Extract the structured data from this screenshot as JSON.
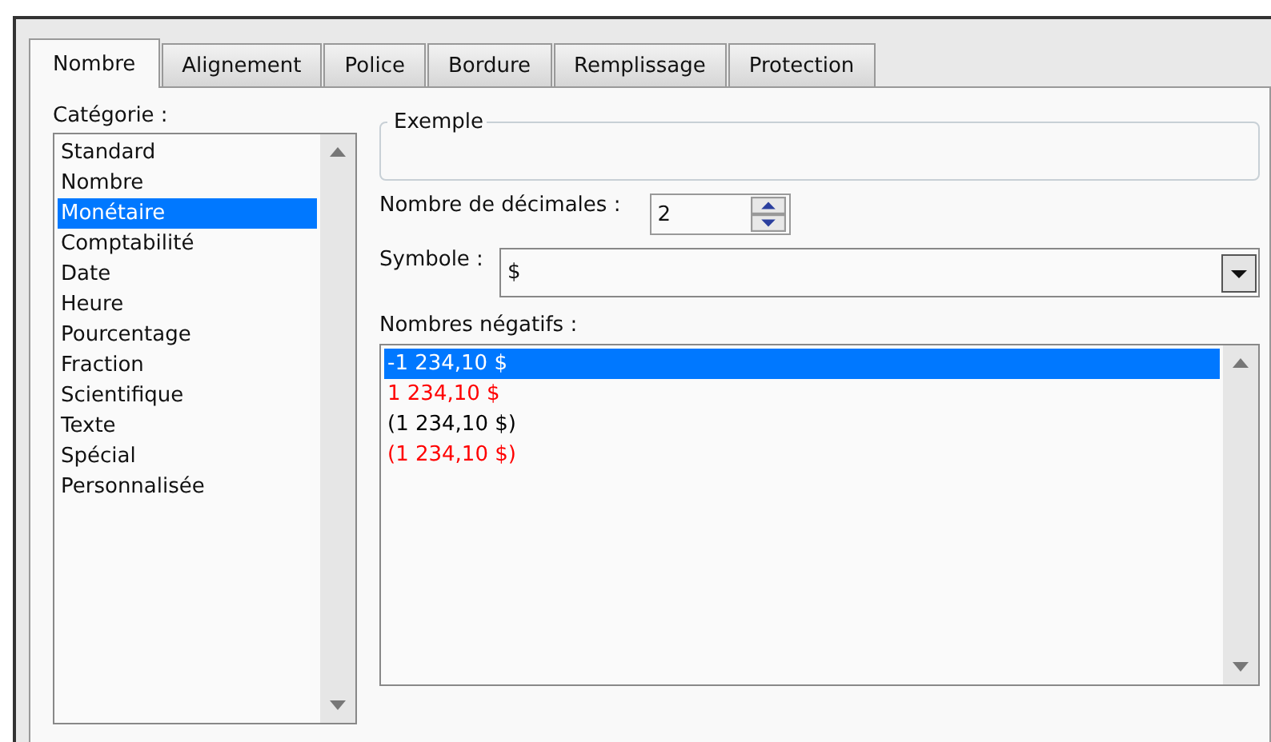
{
  "tabs": [
    {
      "label": "Nombre",
      "selected": true
    },
    {
      "label": "Alignement",
      "selected": false
    },
    {
      "label": "Police",
      "selected": false
    },
    {
      "label": "Bordure",
      "selected": false
    },
    {
      "label": "Remplissage",
      "selected": false
    },
    {
      "label": "Protection",
      "selected": false
    }
  ],
  "category": {
    "label": "Catégorie :",
    "items": [
      {
        "label": "Standard",
        "selected": false
      },
      {
        "label": "Nombre",
        "selected": false
      },
      {
        "label": "Monétaire",
        "selected": true
      },
      {
        "label": "Comptabilité",
        "selected": false
      },
      {
        "label": "Date",
        "selected": false
      },
      {
        "label": "Heure",
        "selected": false
      },
      {
        "label": "Pourcentage",
        "selected": false
      },
      {
        "label": "Fraction",
        "selected": false
      },
      {
        "label": "Scientifique",
        "selected": false
      },
      {
        "label": "Texte",
        "selected": false
      },
      {
        "label": "Spécial",
        "selected": false
      },
      {
        "label": "Personnalisée",
        "selected": false
      }
    ]
  },
  "sample": {
    "legend": "Exemple"
  },
  "decimals": {
    "label": "Nombre de décimales :",
    "value": "2"
  },
  "symbol": {
    "label": "Symbole :",
    "value": "$"
  },
  "negatives": {
    "label": "Nombres négatifs :",
    "items": [
      {
        "label": "-1 234,10 $",
        "selected": true
      },
      {
        "label": "1 234,10 $",
        "color": "#ff0000",
        "selected": false
      },
      {
        "label": "(1 234,10 $)",
        "color": "#000000",
        "selected": false
      },
      {
        "label": "(1 234,10 $)",
        "color": "#ff0000",
        "selected": false
      }
    ]
  }
}
